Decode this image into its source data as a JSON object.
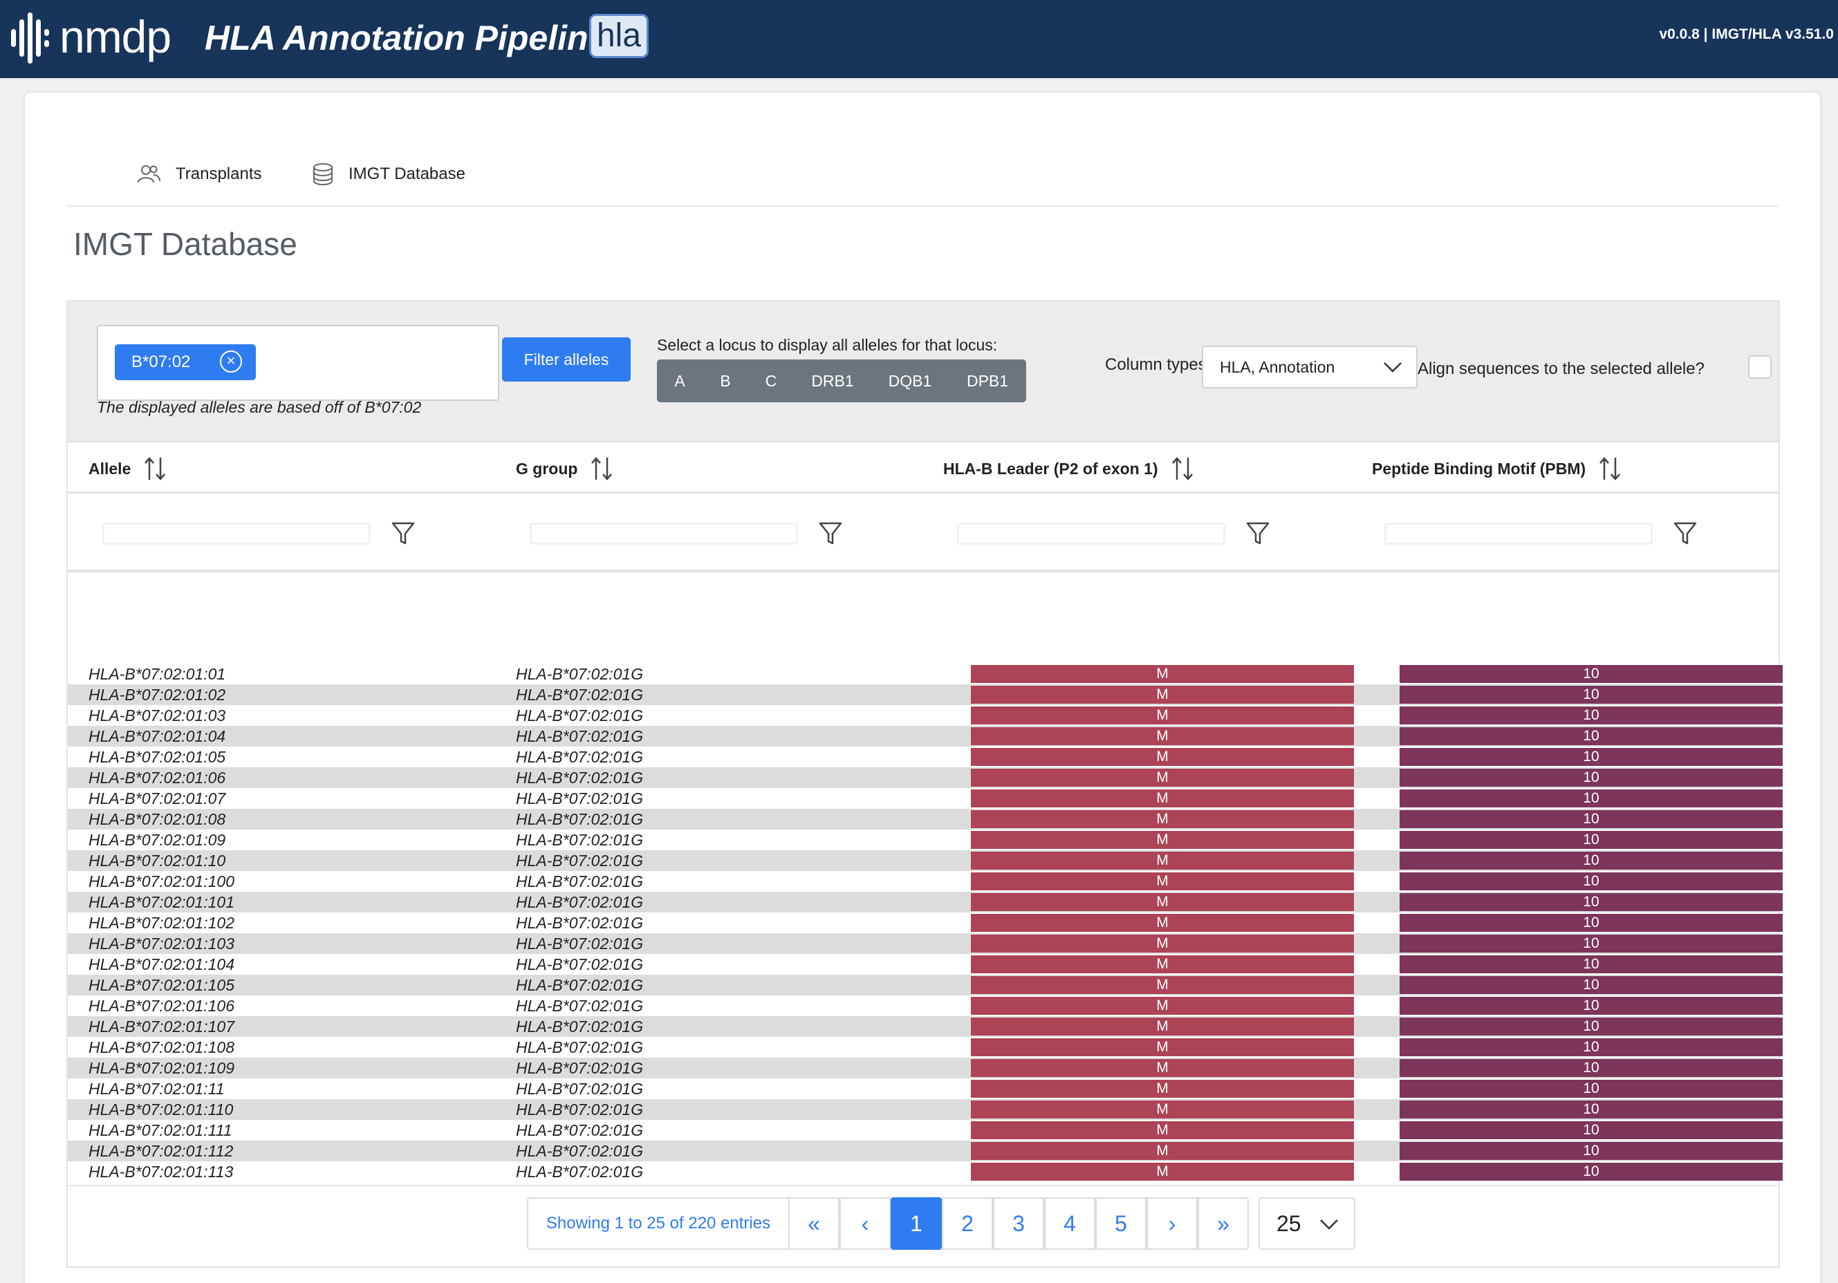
{
  "header": {
    "logo_text": "nmdp",
    "app_title": "HLA Annotation Pipeline",
    "badge_text": "hla",
    "version": "v0.0.8 | IMGT/HLA v3.51.0",
    "background_color": "#17345b"
  },
  "nav": {
    "tabs": [
      {
        "label": "Transplants",
        "icon": "people-icon"
      },
      {
        "label": "IMGT Database",
        "icon": "database-icon"
      }
    ]
  },
  "page": {
    "title": "IMGT Database"
  },
  "toolbar": {
    "selected_chip": "B*07:02",
    "chip_note": "The displayed alleles are based off of B*07:02",
    "filter_button": "Filter alleles",
    "locus_label": "Select a locus to display all alleles for that locus:",
    "loci": [
      "A",
      "B",
      "C",
      "DRB1",
      "DQB1",
      "DPB1"
    ],
    "column_types_label": "Column types:",
    "column_types_value": "HLA, Annotation",
    "align_label": "Align sequences to the selected allele?",
    "align_checked": false,
    "accent_color": "#2f7cf0"
  },
  "table": {
    "columns": [
      "Allele",
      "G group",
      "HLA-B Leader (P2 of exon 1)",
      "Peptide Binding Motif (PBM)"
    ],
    "rows": [
      {
        "allele": "HLA-B*07:02:01:01",
        "ggroup": "HLA-B*07:02:01G",
        "leader": "M",
        "pbm": "10"
      },
      {
        "allele": "HLA-B*07:02:01:02",
        "ggroup": "HLA-B*07:02:01G",
        "leader": "M",
        "pbm": "10"
      },
      {
        "allele": "HLA-B*07:02:01:03",
        "ggroup": "HLA-B*07:02:01G",
        "leader": "M",
        "pbm": "10"
      },
      {
        "allele": "HLA-B*07:02:01:04",
        "ggroup": "HLA-B*07:02:01G",
        "leader": "M",
        "pbm": "10"
      },
      {
        "allele": "HLA-B*07:02:01:05",
        "ggroup": "HLA-B*07:02:01G",
        "leader": "M",
        "pbm": "10"
      },
      {
        "allele": "HLA-B*07:02:01:06",
        "ggroup": "HLA-B*07:02:01G",
        "leader": "M",
        "pbm": "10"
      },
      {
        "allele": "HLA-B*07:02:01:07",
        "ggroup": "HLA-B*07:02:01G",
        "leader": "M",
        "pbm": "10"
      },
      {
        "allele": "HLA-B*07:02:01:08",
        "ggroup": "HLA-B*07:02:01G",
        "leader": "M",
        "pbm": "10"
      },
      {
        "allele": "HLA-B*07:02:01:09",
        "ggroup": "HLA-B*07:02:01G",
        "leader": "M",
        "pbm": "10"
      },
      {
        "allele": "HLA-B*07:02:01:10",
        "ggroup": "HLA-B*07:02:01G",
        "leader": "M",
        "pbm": "10"
      },
      {
        "allele": "HLA-B*07:02:01:100",
        "ggroup": "HLA-B*07:02:01G",
        "leader": "M",
        "pbm": "10"
      },
      {
        "allele": "HLA-B*07:02:01:101",
        "ggroup": "HLA-B*07:02:01G",
        "leader": "M",
        "pbm": "10"
      },
      {
        "allele": "HLA-B*07:02:01:102",
        "ggroup": "HLA-B*07:02:01G",
        "leader": "M",
        "pbm": "10"
      },
      {
        "allele": "HLA-B*07:02:01:103",
        "ggroup": "HLA-B*07:02:01G",
        "leader": "M",
        "pbm": "10"
      },
      {
        "allele": "HLA-B*07:02:01:104",
        "ggroup": "HLA-B*07:02:01G",
        "leader": "M",
        "pbm": "10"
      },
      {
        "allele": "HLA-B*07:02:01:105",
        "ggroup": "HLA-B*07:02:01G",
        "leader": "M",
        "pbm": "10"
      },
      {
        "allele": "HLA-B*07:02:01:106",
        "ggroup": "HLA-B*07:02:01G",
        "leader": "M",
        "pbm": "10"
      },
      {
        "allele": "HLA-B*07:02:01:107",
        "ggroup": "HLA-B*07:02:01G",
        "leader": "M",
        "pbm": "10"
      },
      {
        "allele": "HLA-B*07:02:01:108",
        "ggroup": "HLA-B*07:02:01G",
        "leader": "M",
        "pbm": "10"
      },
      {
        "allele": "HLA-B*07:02:01:109",
        "ggroup": "HLA-B*07:02:01G",
        "leader": "M",
        "pbm": "10"
      },
      {
        "allele": "HLA-B*07:02:01:11",
        "ggroup": "HLA-B*07:02:01G",
        "leader": "M",
        "pbm": "10"
      },
      {
        "allele": "HLA-B*07:02:01:110",
        "ggroup": "HLA-B*07:02:01G",
        "leader": "M",
        "pbm": "10"
      },
      {
        "allele": "HLA-B*07:02:01:111",
        "ggroup": "HLA-B*07:02:01G",
        "leader": "M",
        "pbm": "10"
      },
      {
        "allele": "HLA-B*07:02:01:112",
        "ggroup": "HLA-B*07:02:01G",
        "leader": "M",
        "pbm": "10"
      },
      {
        "allele": "HLA-B*07:02:01:113",
        "ggroup": "HLA-B*07:02:01G",
        "leader": "M",
        "pbm": "10"
      }
    ],
    "leader_color": "#ad4356",
    "pbm_color": "#7d3559"
  },
  "pagination": {
    "showing": "Showing 1 to 25 of 220 entries",
    "first": "«",
    "prev": "‹",
    "pages": [
      "1",
      "2",
      "3",
      "4",
      "5"
    ],
    "current_page": "1",
    "next": "›",
    "last": "»",
    "page_size": "25"
  }
}
